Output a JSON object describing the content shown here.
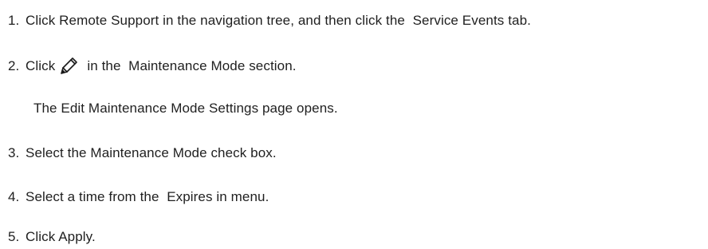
{
  "steps": [
    {
      "number": "1.",
      "text": "Click Remote Support in the navigation tree, and then click the  Service Events tab."
    },
    {
      "number": "2.",
      "text_before": "Click",
      "icon": "pencil-edit-icon",
      "text_after": "in the  Maintenance Mode section.",
      "result": "The Edit Maintenance Mode Settings page opens."
    },
    {
      "number": "3.",
      "text": "Select the Maintenance Mode check box."
    },
    {
      "number": "4.",
      "text": "Select a time from the  Expires in menu."
    },
    {
      "number": "5.",
      "text": "Click Apply."
    }
  ]
}
